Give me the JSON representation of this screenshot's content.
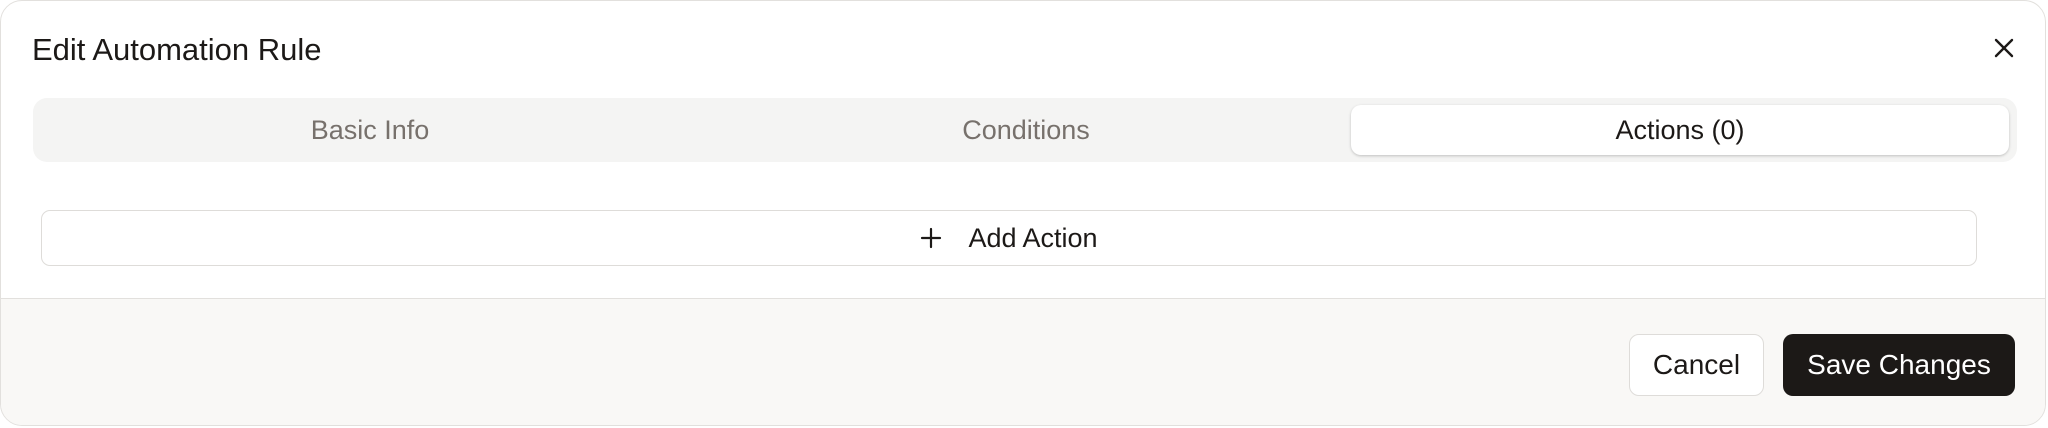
{
  "dialog": {
    "title": "Edit Automation Rule",
    "close_icon": "close-icon"
  },
  "tabs": [
    {
      "label": "Basic Info",
      "active": false
    },
    {
      "label": "Conditions",
      "active": false
    },
    {
      "label": "Actions (0)",
      "active": true
    }
  ],
  "actions": {
    "add_label": "Add Action",
    "add_icon": "plus-icon"
  },
  "footer": {
    "cancel_label": "Cancel",
    "save_label": "Save Changes"
  },
  "colors": {
    "primary": "#1c1917",
    "tab_track": "#f4f4f3",
    "footer_bg": "#f9f8f6",
    "muted_text": "#77716c"
  }
}
